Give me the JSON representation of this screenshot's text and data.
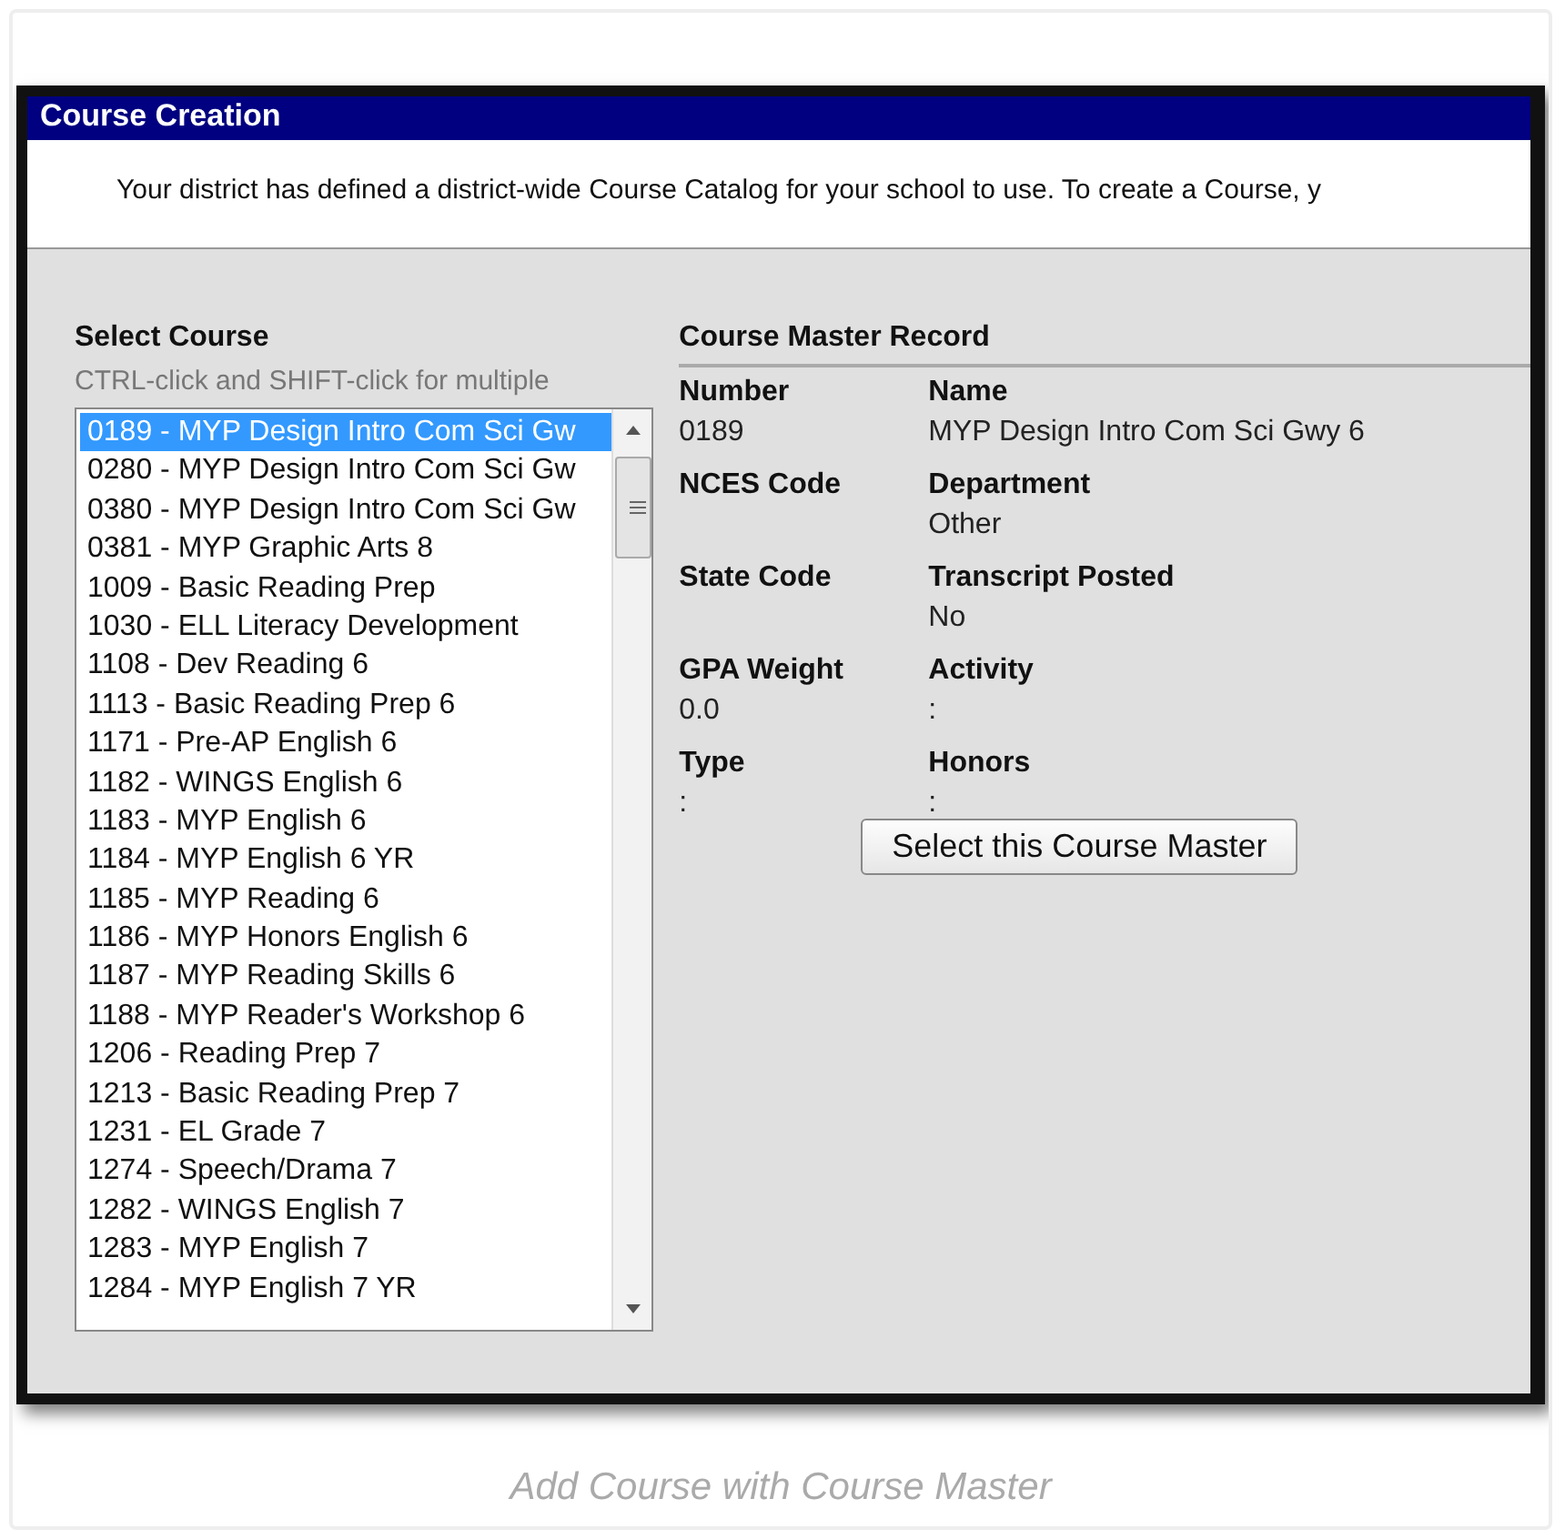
{
  "window": {
    "title": "Course Creation"
  },
  "intro": "Your district has defined a district-wide Course Catalog for your school to use. To create a Course, y",
  "select_course": {
    "heading": "Select Course",
    "hint": "CTRL-click and SHIFT-click for multiple",
    "items": [
      {
        "label": "0189 - MYP Design Intro Com Sci Gw",
        "selected": true
      },
      {
        "label": "0280 - MYP Design Intro Com Sci Gw",
        "selected": false
      },
      {
        "label": "0380 - MYP Design Intro Com Sci Gw",
        "selected": false
      },
      {
        "label": "0381 - MYP Graphic Arts 8",
        "selected": false
      },
      {
        "label": "1009 - Basic Reading Prep",
        "selected": false
      },
      {
        "label": "1030 - ELL Literacy Development",
        "selected": false
      },
      {
        "label": "1108 - Dev Reading 6",
        "selected": false
      },
      {
        "label": "1113 - Basic Reading Prep 6",
        "selected": false
      },
      {
        "label": "1171 - Pre-AP English 6",
        "selected": false
      },
      {
        "label": "1182 - WINGS English 6",
        "selected": false
      },
      {
        "label": "1183 - MYP English 6",
        "selected": false
      },
      {
        "label": "1184 - MYP English 6 YR",
        "selected": false
      },
      {
        "label": "1185 - MYP Reading 6",
        "selected": false
      },
      {
        "label": "1186 - MYP Honors English 6",
        "selected": false
      },
      {
        "label": "1187 - MYP Reading Skills 6",
        "selected": false
      },
      {
        "label": "1188 - MYP Reader's Workshop 6",
        "selected": false
      },
      {
        "label": "1206 - Reading Prep 7",
        "selected": false
      },
      {
        "label": "1213 - Basic Reading Prep 7",
        "selected": false
      },
      {
        "label": "1231 - EL Grade 7",
        "selected": false
      },
      {
        "label": "1274 - Speech/Drama 7",
        "selected": false
      },
      {
        "label": "1282 - WINGS English 7",
        "selected": false
      },
      {
        "label": "1283 - MYP English 7",
        "selected": false
      },
      {
        "label": "1284 - MYP English 7 YR",
        "selected": false
      }
    ]
  },
  "course_master_record": {
    "heading": "Course Master Record",
    "fields": [
      {
        "label": "Number",
        "value": "0189"
      },
      {
        "label": "Name",
        "value": "MYP Design Intro Com Sci Gwy 6"
      },
      {
        "label": "NCES Code"
      },
      {
        "label": "Department",
        "value": "Other"
      },
      {
        "label": "State Code"
      },
      {
        "label": "Transcript Posted",
        "value": "No"
      },
      {
        "label": "GPA Weight",
        "value": "0.0"
      },
      {
        "label": "Activity",
        "value": ":"
      },
      {
        "label": "Type",
        "value": ":"
      },
      {
        "label": "Honors",
        "value": ":"
      }
    ],
    "button": "Select this Course Master"
  },
  "caption": "Add Course with Course Master"
}
